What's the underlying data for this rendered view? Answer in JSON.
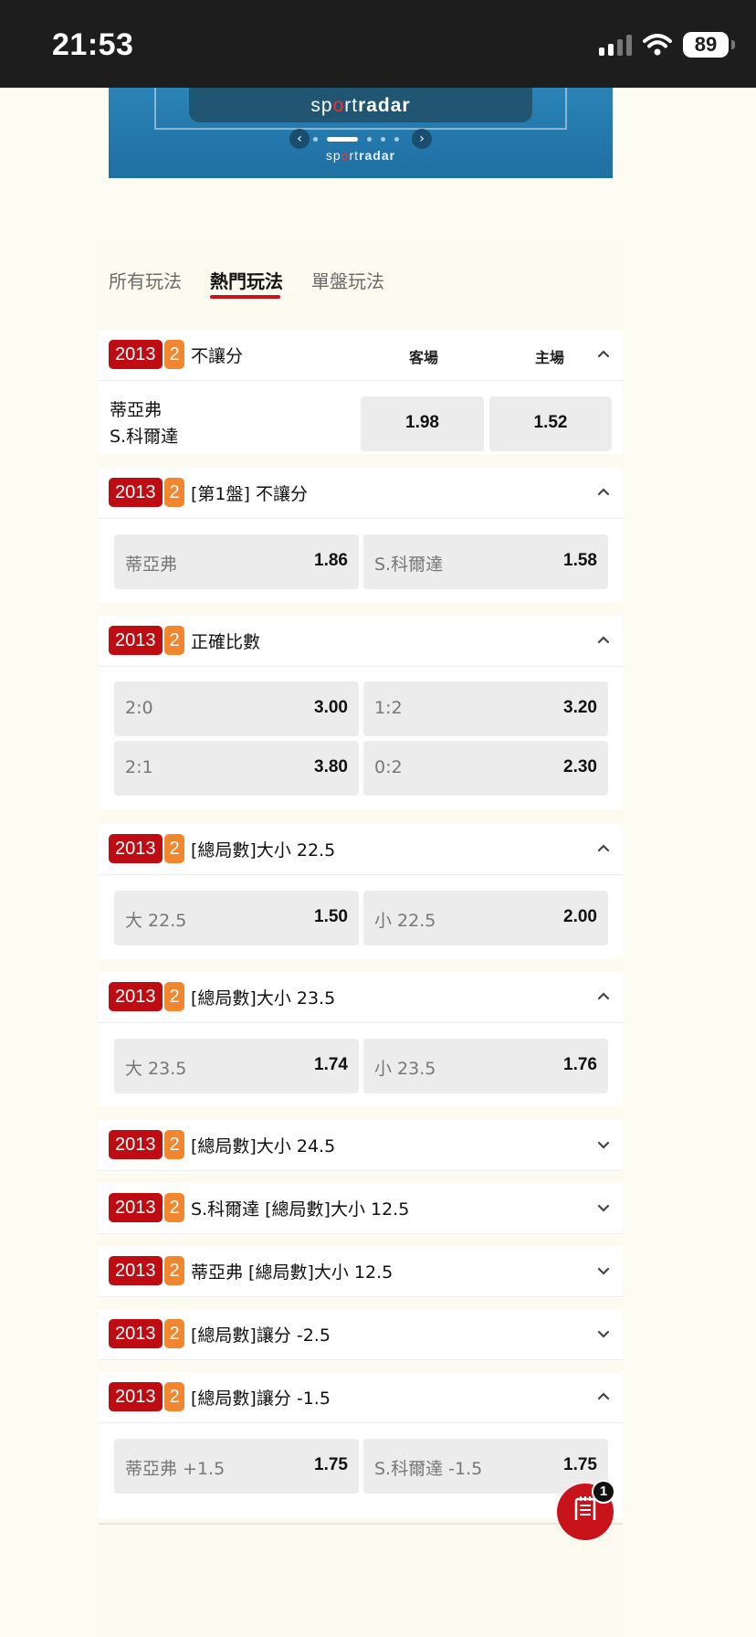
{
  "status_bar": {
    "time": "21:53",
    "battery": "89"
  },
  "banner": {
    "brand": [
      "sp",
      "o",
      "rt",
      "radar"
    ]
  },
  "tabs": [
    {
      "label": "所有玩法",
      "active": false
    },
    {
      "label": "熱門玩法",
      "active": true
    },
    {
      "label": "單盤玩法",
      "active": false
    }
  ],
  "markets": [
    {
      "badge_id": "2013",
      "badge_n": "2",
      "title": "不讓分",
      "expanded": true,
      "columns": [
        "客場",
        "主場"
      ],
      "teams": [
        "蒂亞弗",
        "S.科爾達"
      ],
      "odds": [
        "1.98",
        "1.52"
      ]
    },
    {
      "badge_id": "2013",
      "badge_n": "2",
      "title": "[第1盤] 不讓分",
      "expanded": true,
      "selections": [
        {
          "label": "蒂亞弗",
          "odds": "1.86"
        },
        {
          "label": "S.科爾達",
          "odds": "1.58"
        }
      ]
    },
    {
      "badge_id": "2013",
      "badge_n": "2",
      "title": "正確比數",
      "expanded": true,
      "selections": [
        {
          "label": "2:0",
          "odds": "3.00"
        },
        {
          "label": "1:2",
          "odds": "3.20"
        },
        {
          "label": "2:1",
          "odds": "3.80"
        },
        {
          "label": "0:2",
          "odds": "2.30"
        }
      ]
    },
    {
      "badge_id": "2013",
      "badge_n": "2",
      "title": "[總局數]大小 22.5",
      "expanded": true,
      "selections": [
        {
          "label": "大 22.5",
          "odds": "1.50"
        },
        {
          "label": "小 22.5",
          "odds": "2.00"
        }
      ]
    },
    {
      "badge_id": "2013",
      "badge_n": "2",
      "title": "[總局數]大小 23.5",
      "expanded": true,
      "selections": [
        {
          "label": "大 23.5",
          "odds": "1.74"
        },
        {
          "label": "小 23.5",
          "odds": "1.76"
        }
      ]
    },
    {
      "badge_id": "2013",
      "badge_n": "2",
      "title": "[總局數]大小 24.5",
      "expanded": false
    },
    {
      "badge_id": "2013",
      "badge_n": "2",
      "title": "S.科爾達 [總局數]大小 12.5",
      "expanded": false
    },
    {
      "badge_id": "2013",
      "badge_n": "2",
      "title": "蒂亞弗 [總局數]大小 12.5",
      "expanded": false
    },
    {
      "badge_id": "2013",
      "badge_n": "2",
      "title": "[總局數]讓分 -2.5",
      "expanded": false
    },
    {
      "badge_id": "2013",
      "badge_n": "2",
      "title": "[總局數]讓分 -1.5",
      "expanded": true,
      "selections": [
        {
          "label": "蒂亞弗 +1.5",
          "odds": "1.75"
        },
        {
          "label": "S.科爾達 -1.5",
          "odds": "1.75"
        }
      ]
    }
  ],
  "bet_slip": {
    "count": "1",
    "icon": "betslip-icon"
  },
  "colors": {
    "brand_red": "#c8131a",
    "badge_orange": "#f1862f",
    "status_bar": "#1d1d1d",
    "background": "#fdfcf3"
  }
}
